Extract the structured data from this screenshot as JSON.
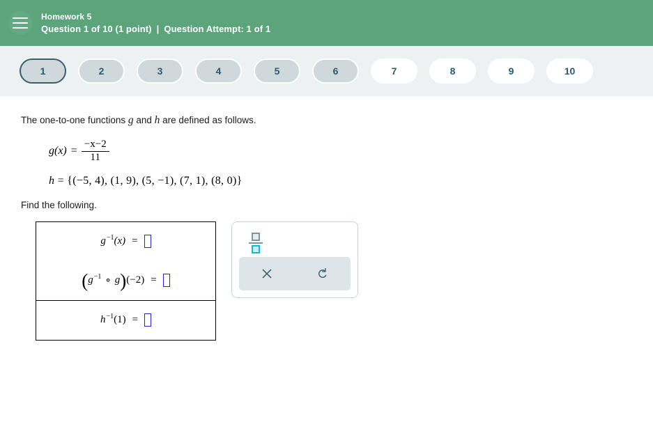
{
  "header": {
    "menu_icon": "hamburger-icon",
    "homework_title": "Homework 5",
    "question_counter": "Question 1 of 10 (1 point)",
    "separator": "|",
    "attempt": "Question Attempt: 1 of 1",
    "background_color": "#5ba47c"
  },
  "pillbar": {
    "background_color": "#eef1f2",
    "current_index": 0,
    "pills": [
      {
        "label": "1",
        "state": "current"
      },
      {
        "label": "2",
        "state": "visited"
      },
      {
        "label": "3",
        "state": "visited"
      },
      {
        "label": "4",
        "state": "visited"
      },
      {
        "label": "5",
        "state": "visited"
      },
      {
        "label": "6",
        "state": "visited"
      },
      {
        "label": "7",
        "state": "unvisited"
      },
      {
        "label": "8",
        "state": "unvisited"
      },
      {
        "label": "9",
        "state": "unvisited"
      },
      {
        "label": "10",
        "state": "unvisited"
      }
    ]
  },
  "problem": {
    "intro_before": "The one-to-one functions ",
    "intro_g": "g",
    "intro_mid": " and ",
    "intro_h": "h",
    "intro_after": " are defined as follows.",
    "g_definition": {
      "name": "g",
      "arg": "(x)",
      "equals": "=",
      "numerator": "−x−2",
      "denominator": "11"
    },
    "h_definition": {
      "name": "h",
      "equals": "=",
      "set": "{(−5, 4), (1, 9), (5, −1), (7, 1), (8, 0)}"
    },
    "instruction": "Find the following."
  },
  "answers": {
    "input_border_color": "#2222dd",
    "rows": [
      {
        "id": "g-inverse-of-x",
        "base": "g",
        "exponent": "−1",
        "arg": "(x)",
        "equals": "=",
        "value": "",
        "placeholder": ""
      },
      {
        "id": "g-inverse-composed-g-at-minus-2",
        "open_paren": "(",
        "base": "g",
        "exponent": "−1",
        "compose": "∘",
        "base2": "g",
        "close_paren": ")",
        "arg": "(−2)",
        "equals": "=",
        "value": "",
        "placeholder": ""
      },
      {
        "id": "h-inverse-of-1",
        "base": "h",
        "exponent": "−1",
        "arg": "(1)",
        "equals": "=",
        "value": "",
        "placeholder": ""
      }
    ]
  },
  "mathbar": {
    "fraction_tool": "fraction-icon",
    "clear_label": "×",
    "undo_label": "↺",
    "actions_background": "#dde5e8",
    "highlight_color": "#19b6d4"
  }
}
